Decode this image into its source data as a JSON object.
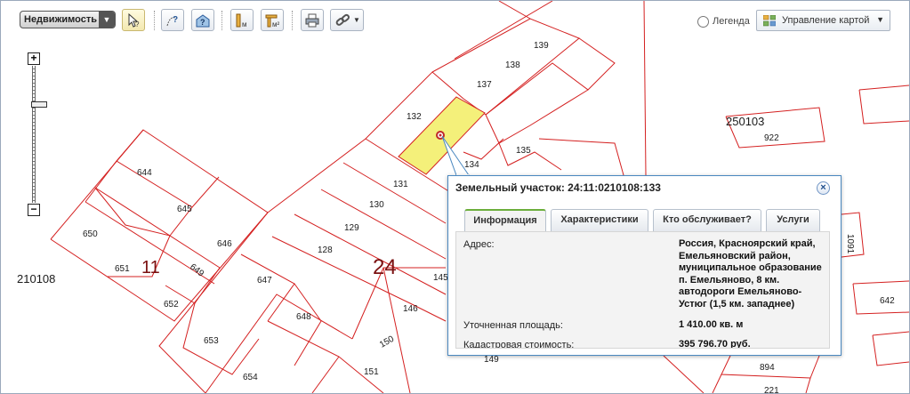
{
  "toolbar": {
    "category": "Недвижимость",
    "legend_label": "Легенда",
    "map_control_label": "Управление картой",
    "tools": [
      "pointer-info-icon",
      "route-info-icon",
      "area-info-icon",
      "measure-length-icon",
      "measure-area-icon",
      "print-icon",
      "link-icon"
    ]
  },
  "zoom": {
    "plus": "+",
    "minus": "−"
  },
  "map": {
    "line_color": "#d42020",
    "highlight_color": "#f4f07a",
    "big_labels": {
      "block11": "11",
      "block24": "24"
    },
    "district_labels": {
      "left": "210108",
      "right": "250103"
    },
    "parcels": {
      "p139": "139",
      "p138": "138",
      "p137": "137",
      "p132": "132",
      "p135": "135",
      "p134": "134",
      "p131": "131",
      "p130": "130",
      "p129": "129",
      "p128": "128",
      "p145": "145",
      "p146": "146",
      "p150": "150",
      "p151": "151",
      "p149": "149",
      "p644": "644",
      "p645": "645",
      "p646": "646",
      "p647": "647",
      "p648": "648",
      "p649": "649",
      "p650": "650",
      "p651": "651",
      "p652": "652",
      "p653": "653",
      "p654": "654",
      "p922": "922",
      "p1091": "1091",
      "p642": "642",
      "p894": "894",
      "p221": "221"
    }
  },
  "popup": {
    "title": "Земельный участок: 24:11:0210108:133",
    "tabs": [
      "Информация",
      "Характеристики",
      "Кто обслуживает?",
      "Услуги"
    ],
    "address_label": "Адрес:",
    "address_value": "Россия, Красноярский край, Емельяновский район, муниципальное образование п. Емельяново, 8 км. автодороги Емельяново-Устюг (1,5 км. западнее)",
    "area_label": "Уточненная площадь:",
    "area_value": "1 410.00 кв. м",
    "cost_label": "Кадастровая стоимость:",
    "cost_value": "395 796.70 руб."
  }
}
